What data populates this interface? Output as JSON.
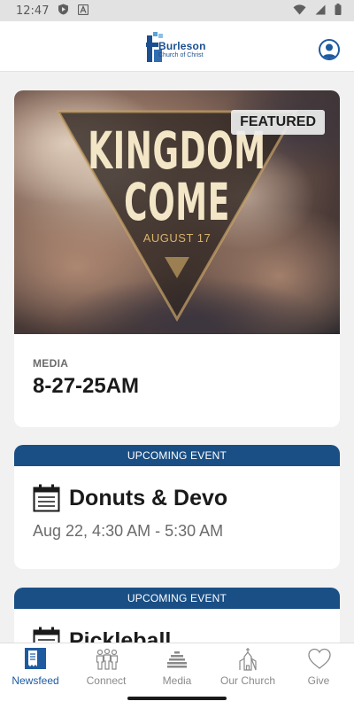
{
  "status_bar": {
    "time": "12:47",
    "icons": [
      "shield-app-icon",
      "a-app-icon",
      "wifi-icon",
      "cellular-icon",
      "battery-icon"
    ]
  },
  "header": {
    "logo_name": "Burleson",
    "logo_sub": "Church of Christ",
    "profile_icon": "user-icon"
  },
  "featured_card": {
    "hero_line1": "KINGDOM",
    "hero_line2": "COME",
    "hero_date": "AUGUST 17",
    "badge": "FEATURED",
    "category": "MEDIA",
    "title": "8-27-25AM"
  },
  "events": [
    {
      "header": "UPCOMING EVENT",
      "title": "Donuts & Devo",
      "date": "Aug 22, 4:30 AM - 5:30 AM",
      "icon": "calendar-icon"
    },
    {
      "header": "UPCOMING EVENT",
      "title": "Pickleball",
      "icon": "calendar-icon"
    }
  ],
  "bottom_nav": [
    {
      "label": "Newsfeed",
      "icon": "newsfeed-icon",
      "active": true
    },
    {
      "label": "Connect",
      "icon": "people-icon",
      "active": false
    },
    {
      "label": "Media",
      "icon": "media-icon",
      "active": false
    },
    {
      "label": "Our Church",
      "icon": "church-icon",
      "active": false
    },
    {
      "label": "Give",
      "icon": "heart-icon",
      "active": false
    }
  ],
  "colors": {
    "brand_blue": "#1a4f85",
    "active_nav": "#1e5aa0",
    "inactive_nav": "#8a8a8a",
    "background": "#f1f1f1"
  }
}
